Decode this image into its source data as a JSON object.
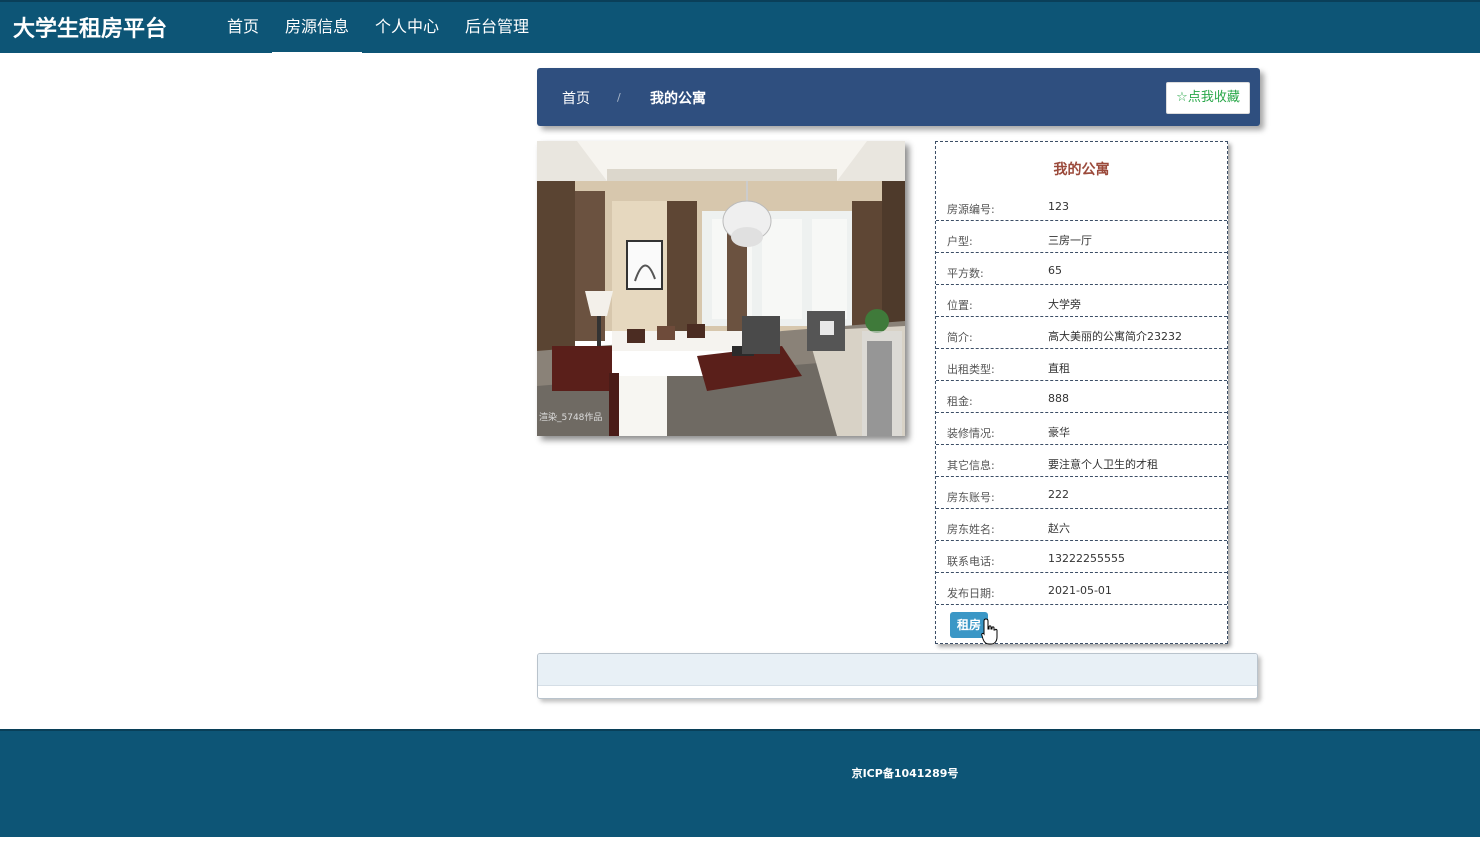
{
  "header": {
    "brand": "大学生租房平台",
    "nav": [
      {
        "label": "首页"
      },
      {
        "label": "房源信息",
        "active": true
      },
      {
        "label": "个人中心"
      },
      {
        "label": "后台管理"
      }
    ]
  },
  "breadcrumb": {
    "home": "首页",
    "separator": "/",
    "current": "我的公寓",
    "favorite_label": "☆点我收藏"
  },
  "detail": {
    "title": "我的公寓",
    "fields": [
      {
        "label": "房源编号:",
        "value": "123"
      },
      {
        "label": "户型:",
        "value": "三房一厅"
      },
      {
        "label": "平方数:",
        "value": "65"
      },
      {
        "label": "位置:",
        "value": "大学旁"
      },
      {
        "label": "简介:",
        "value": "高大美丽的公寓简介23232"
      },
      {
        "label": "出租类型:",
        "value": "直租"
      },
      {
        "label": "租金:",
        "value": "888"
      },
      {
        "label": "装修情况:",
        "value": "豪华"
      },
      {
        "label": "其它信息:",
        "value": "要注意个人卫生的才租"
      },
      {
        "label": "房东账号:",
        "value": "222"
      },
      {
        "label": "房东姓名:",
        "value": "赵六"
      },
      {
        "label": "联系电话:",
        "value": "13222255555"
      },
      {
        "label": "发布日期:",
        "value": "2021-05-01"
      }
    ],
    "rent_button": "租房"
  },
  "photo_watermark": "渲染_5748作品",
  "footer": {
    "icp": "京ICP备1041289号"
  },
  "colors": {
    "topbar": "#0d5576",
    "crumbbar": "#2f4f7f",
    "favorite_text": "#2aa84a",
    "title_text": "#9b4a3b",
    "rent_button": "#3b97c6"
  }
}
